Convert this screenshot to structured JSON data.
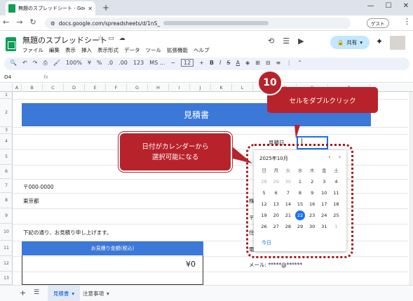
{
  "browser": {
    "tab_title": "無題のスプレッドシート - Google ス",
    "tab_close": "✕",
    "new_tab": "+",
    "url": "docs.google.com/spreadsheets/d/1nS_",
    "guest_label": "ゲスト",
    "window_buttons": [
      "—",
      "☐",
      "✕"
    ]
  },
  "sheets": {
    "doc_title": "無題のスプレッドシート",
    "menus": [
      "ファイル",
      "編集",
      "表示",
      "挿入",
      "表示形式",
      "データ",
      "ツール",
      "拡張機能",
      "ヘルプ"
    ],
    "share_label": "共有",
    "zoom": "100%",
    "currency": "¥",
    "percent": "%",
    "dec_dec": ".0",
    "dec_inc": ".00",
    "num123": "123",
    "font": "MS ...",
    "font_size": "12",
    "name_box": "O4",
    "fx": "fx"
  },
  "grid": {
    "columns": [
      "A",
      "B",
      "C",
      "D",
      "E",
      "F",
      "G",
      "H",
      "I",
      "J",
      "K",
      "L",
      "M",
      "N",
      "O",
      "P"
    ],
    "rows": [
      "1",
      "2",
      "3",
      "4",
      "5",
      "6",
      "7",
      "8",
      "9",
      "10",
      "11",
      "12",
      "13"
    ],
    "banner": "見積書",
    "postal": "〒000-0000",
    "city": "東京都",
    "greeting": "下記の通り、お見積り申し上げます。",
    "amount_header": "お見積り金額(税込)",
    "amount": "¥0",
    "quote_date_label": "見積日",
    "side_chars": [
      "株",
      "〒",
      "住",
      "電"
    ],
    "mail": "メール: *****@******"
  },
  "calendar": {
    "month": "2025年10月",
    "weekdays": [
      "日",
      "月",
      "火",
      "水",
      "木",
      "金",
      "土"
    ],
    "weeks": [
      [
        "28",
        "29",
        "30",
        "1",
        "2",
        "3",
        "4"
      ],
      [
        "5",
        "6",
        "7",
        "8",
        "9",
        "10",
        "11"
      ],
      [
        "12",
        "13",
        "14",
        "15",
        "16",
        "17",
        "18"
      ],
      [
        "19",
        "20",
        "21",
        "22",
        "23",
        "24",
        "25"
      ],
      [
        "26",
        "27",
        "28",
        "29",
        "30",
        "31",
        "1"
      ]
    ],
    "selected_day": "22",
    "today_label": "今日"
  },
  "annotations": {
    "step_number": "10",
    "callout_top": "セルをダブルクリック",
    "callout_left_line1": "日付がカレンダーから",
    "callout_left_line2": "選択可能になる"
  },
  "bottom": {
    "sheet_tabs": [
      "見積書",
      "注意事項"
    ]
  }
}
